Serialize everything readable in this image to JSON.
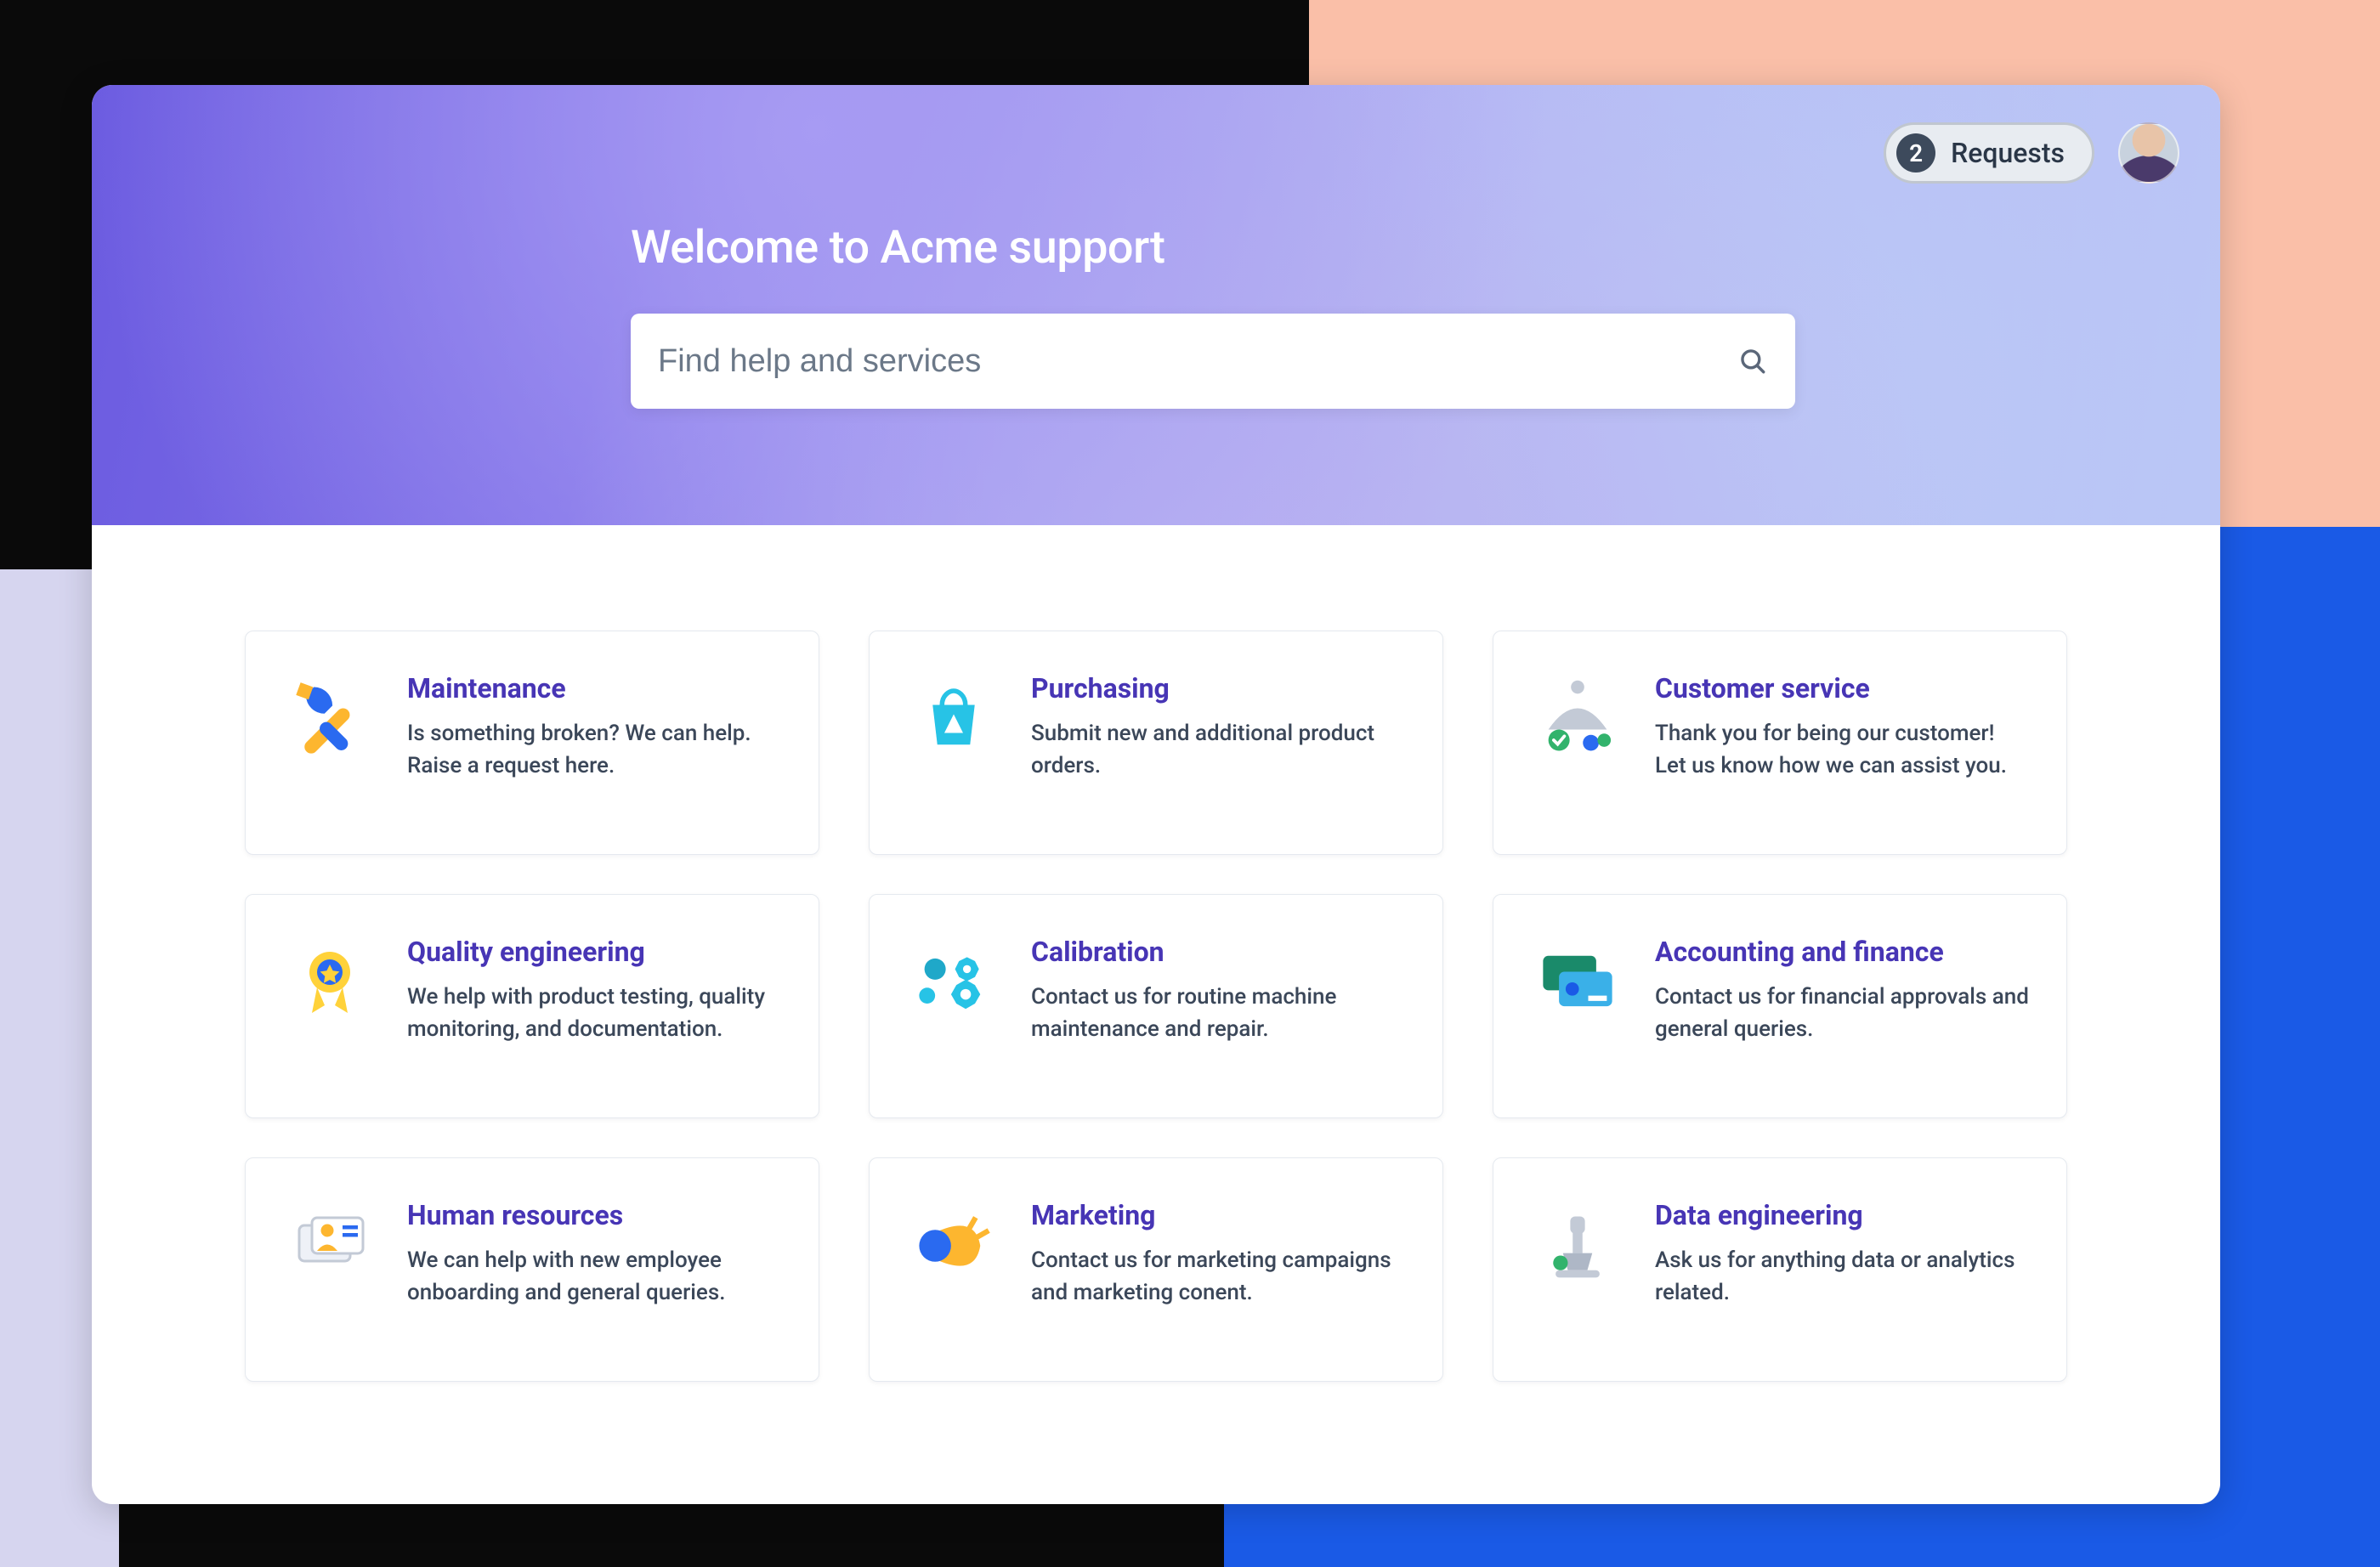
{
  "header": {
    "title": "Welcome to Acme support",
    "requests_count": "2",
    "requests_label": "Requests"
  },
  "search": {
    "placeholder": "Find help and services"
  },
  "services": [
    {
      "icon": "maintenance-icon",
      "title": "Maintenance",
      "desc": "Is something broken? We can help. Raise a request here."
    },
    {
      "icon": "purchasing-icon",
      "title": "Purchasing",
      "desc": "Submit new and additional product orders."
    },
    {
      "icon": "customer-service-icon",
      "title": "Customer service",
      "desc": "Thank you for being our customer! Let us know how we can assist you."
    },
    {
      "icon": "quality-engineering-icon",
      "title": "Quality engineering",
      "desc": "We help with product testing, quality monitoring, and documentation."
    },
    {
      "icon": "calibration-icon",
      "title": "Calibration",
      "desc": "Contact us for routine machine maintenance and repair."
    },
    {
      "icon": "accounting-finance-icon",
      "title": "Accounting and finance",
      "desc": "Contact us for financial approvals and general queries."
    },
    {
      "icon": "human-resources-icon",
      "title": "Human resources",
      "desc": "We can help with new employee onboarding and general queries."
    },
    {
      "icon": "marketing-icon",
      "title": "Marketing",
      "desc": "Contact us for marketing campaigns and marketing conent."
    },
    {
      "icon": "data-engineering-icon",
      "title": "Data engineering",
      "desc": "Ask us for anything data or analytics related."
    }
  ]
}
